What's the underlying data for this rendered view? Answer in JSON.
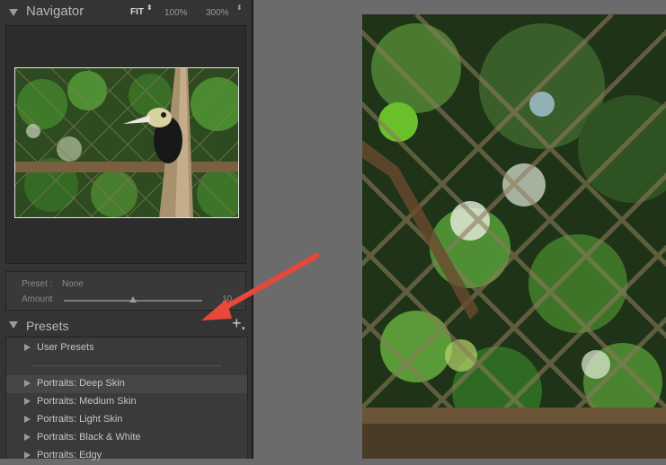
{
  "navigator": {
    "title": "Navigator",
    "zoom_fit": "FIT",
    "zoom_fit_arrows": "⬍",
    "zoom_100": "100%",
    "zoom_300": "300%",
    "zoom_300_arrows": "⬍"
  },
  "preset_amount": {
    "preset_label": "Preset :",
    "preset_value": "None",
    "amount_label": "Amount",
    "amount_value": "10",
    "amount_level": 0.5
  },
  "presets": {
    "title": "Presets",
    "add_label": "+",
    "add_caret": "▾",
    "items": [
      {
        "label": "User Presets"
      },
      {
        "label": "Portraits: Deep Skin"
      },
      {
        "label": "Portraits: Medium Skin"
      },
      {
        "label": "Portraits: Light Skin"
      },
      {
        "label": "Portraits: Black & White"
      },
      {
        "label": "Portraits: Edgy"
      }
    ]
  },
  "colors": {
    "panel_bg": "#343434",
    "workspace_bg": "#6b6b6b",
    "annotation_arrow": "#e8473a"
  }
}
